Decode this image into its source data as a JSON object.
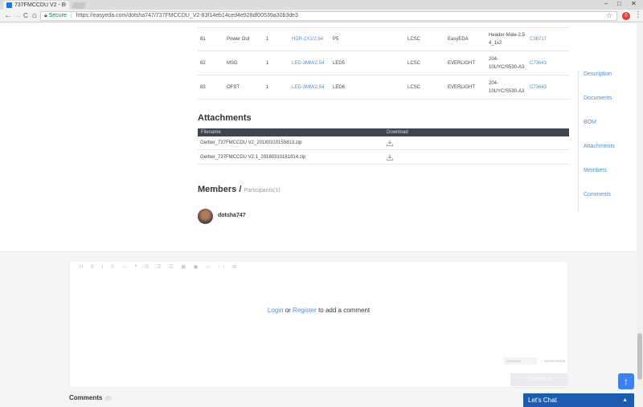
{
  "browser": {
    "tab_title": "737FMCCDU V2 - E",
    "tab_close": "×",
    "nav_back": "←",
    "nav_forward": "→",
    "nav_reload": "C",
    "nav_home": "⌂",
    "secure_label": "Secure",
    "url": "https://easyeda.com/dotsha747/737FMCCDU_V2-83f14eb14ced4e928df00539a30b3de3",
    "star": "☆",
    "extension_badge": "0",
    "menu": "⋮"
  },
  "bom": {
    "rows": [
      {
        "no": "81",
        "name": "Power Out",
        "qty": "1",
        "footprint": "HDR-2X1/2.54",
        "designator": "P5",
        "supplier": "LCSC",
        "manufacturer": "EasyEDA",
        "mpn": "Header-Male-2.5 4_1x2",
        "part": "C36717"
      },
      {
        "no": "82",
        "name": "MSG",
        "qty": "1",
        "footprint": "LED-3MM/2.54",
        "designator": "LED5",
        "supplier": "LCSC",
        "manufacturer": "EVERLIGHT",
        "mpn": "204-10UYC/S530-A3",
        "part": "C73643"
      },
      {
        "no": "83",
        "name": "OFST",
        "qty": "1",
        "footprint": "LED-3MM/2.54",
        "designator": "LED6",
        "supplier": "LCSC",
        "manufacturer": "EVERLIGHT",
        "mpn": "204-10UYC/S530-A3",
        "part": "C73643"
      }
    ]
  },
  "attachments": {
    "title": "Attachments",
    "col_filename": "Filename",
    "col_download": "Download",
    "files": [
      {
        "name": "Gerber_737FMCCDU V2_20180310155813.zip"
      },
      {
        "name": "Gerber_737FMCCDU V2.1_20180310161814.zip"
      }
    ]
  },
  "members": {
    "title": "Members /",
    "participants": "Participants(1)",
    "list": [
      {
        "name": "dotsha747"
      }
    ]
  },
  "sidenav": {
    "items": [
      "Description",
      "Documents",
      "BOM",
      "Attachments",
      "Members",
      "Comments"
    ]
  },
  "editor": {
    "tools": "H B I S — ❝ ☰ ☰ ☰ ▦ ▣ ▭ ‹› ⊞",
    "login": "Login",
    "or": "or",
    "register": "Register",
    "add_comment": "to add a comment",
    "nickname_placeholder": "Nickname",
    "anonymous": "ANONYMOUS",
    "comment_button": "Comment"
  },
  "comments": {
    "title": "Comments",
    "count": "(0)"
  },
  "widgets": {
    "to_top": "↑",
    "chat_label": "Let's Chat",
    "chat_chevron": "▲"
  },
  "colors": {
    "link": "#4a90d9",
    "table_header": "#3e4451",
    "chat": "#1e5cb3",
    "to_top": "#3b82f6"
  }
}
